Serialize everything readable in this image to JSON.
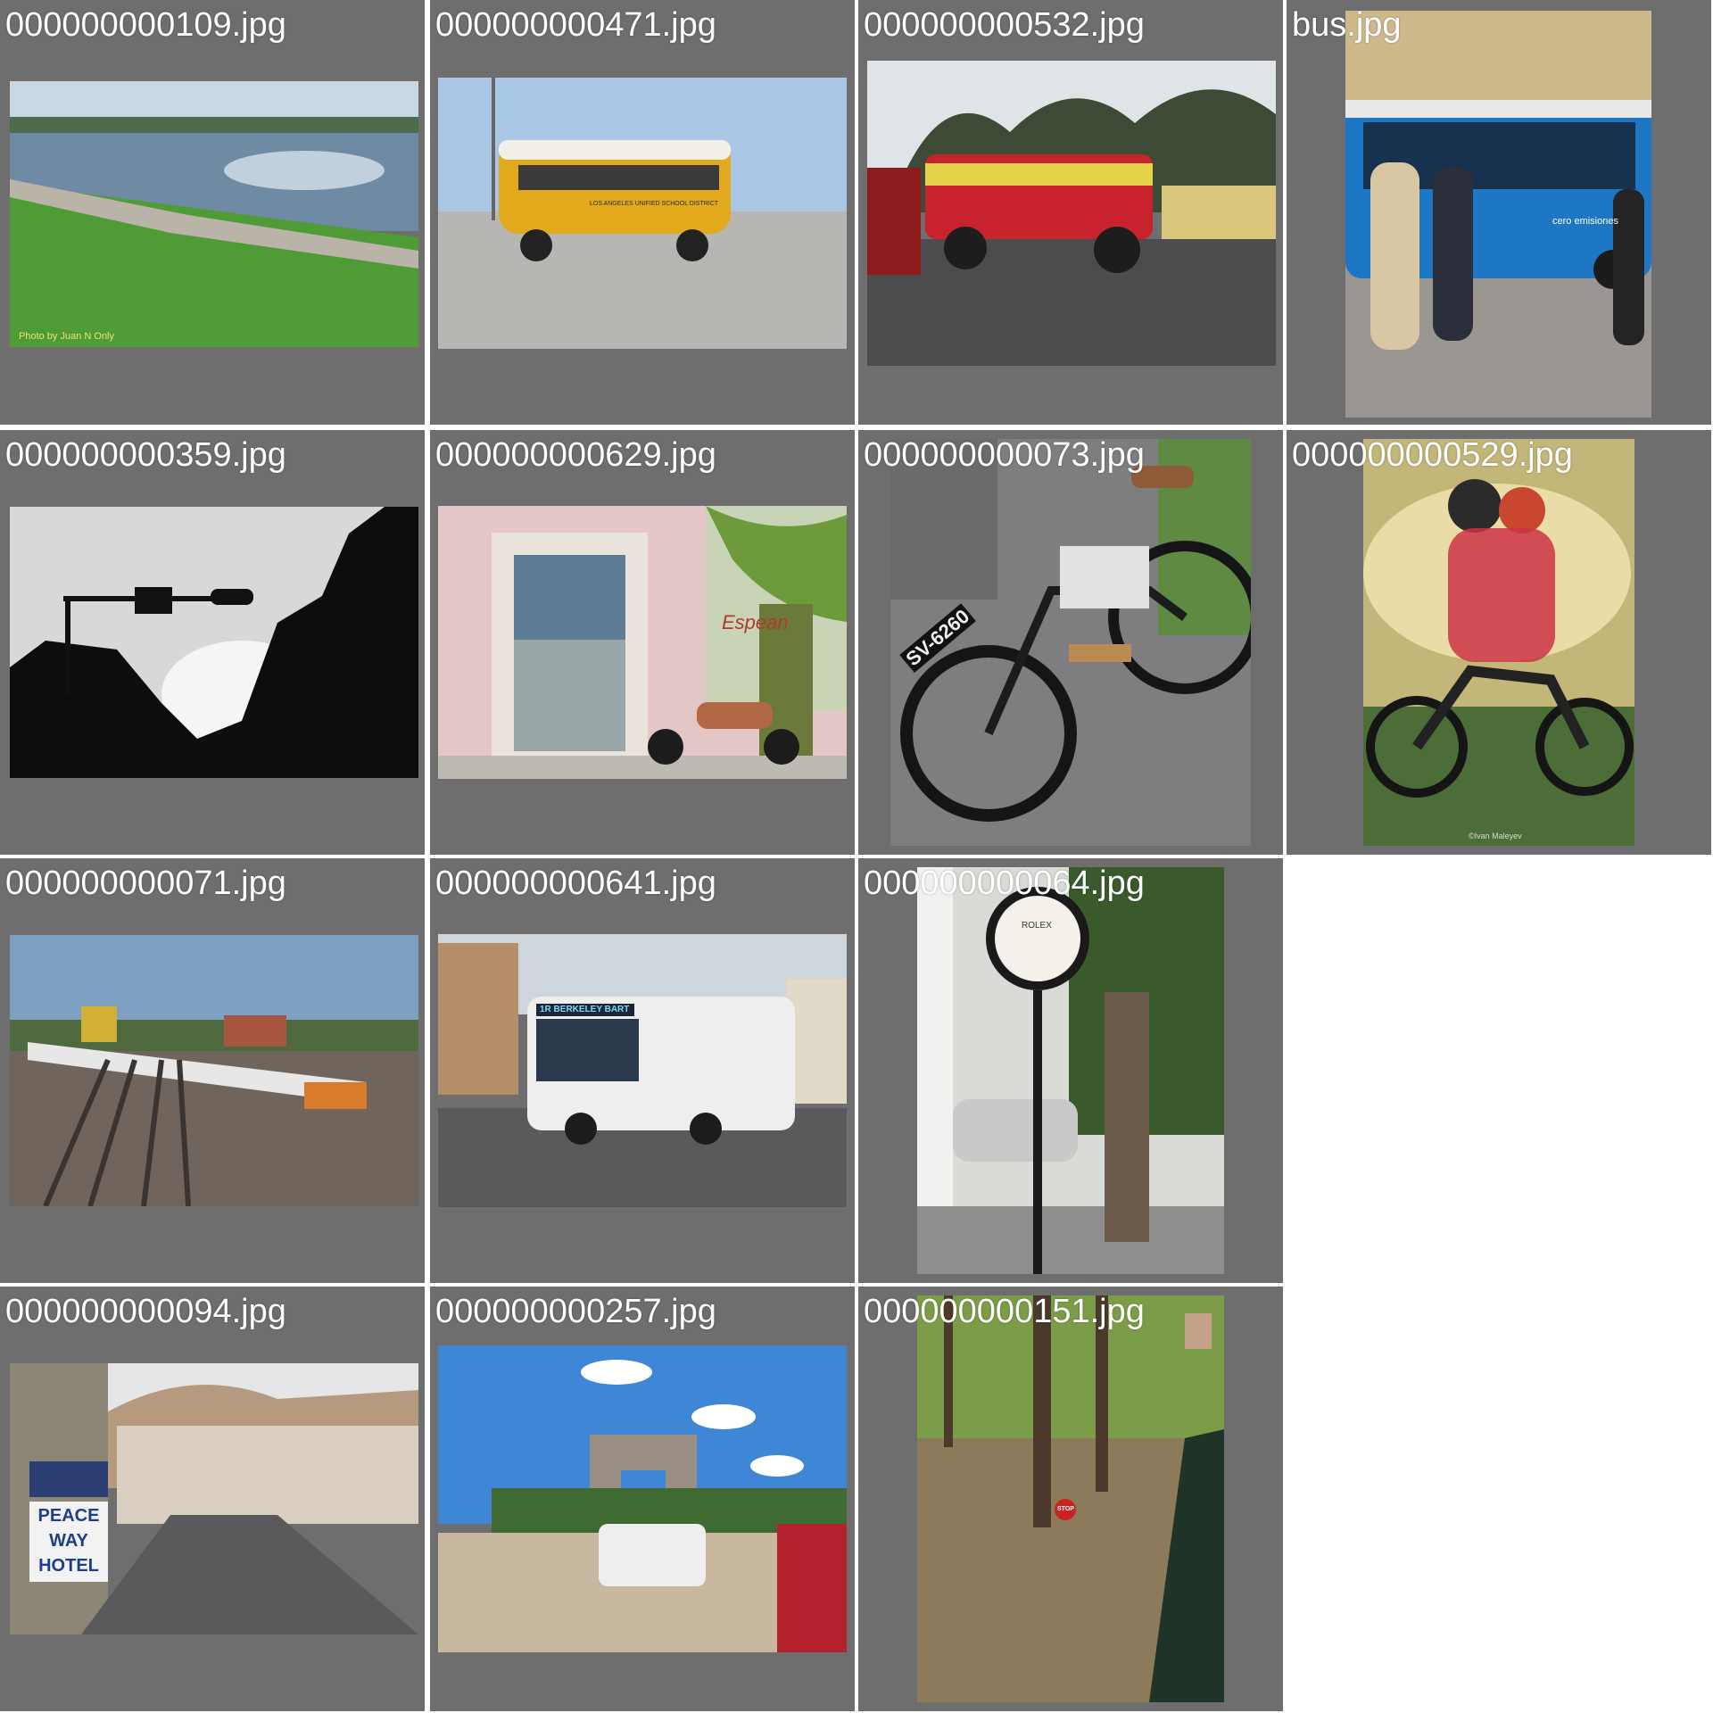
{
  "viewer": {
    "background": "#ffffff",
    "tile_background": "#6e6e6e",
    "label_color": "#ffffff"
  },
  "tiles": [
    {
      "filename": "000000000109.jpg",
      "icon": "waterfront-park-photo",
      "caption": "Photo by Juan N Only"
    },
    {
      "filename": "000000000471.jpg",
      "icon": "yellow-school-bus-photo",
      "bus_text": "LOS ANGELES UNIFIED SCHOOL DISTRICT"
    },
    {
      "filename": "000000000532.jpg",
      "icon": "chicken-bus-photo"
    },
    {
      "filename": "bus.jpg",
      "icon": "electric-bus-photo",
      "bus_text": "cero emisiones"
    },
    {
      "filename": "000000000359.jpg",
      "icon": "traffic-light-silhouette-photo"
    },
    {
      "filename": "000000000629.jpg",
      "icon": "door-and-minibike-photo",
      "wall_text": "Espean"
    },
    {
      "filename": "000000000073.jpg",
      "icon": "vintage-motorcycle-photo",
      "plate": "SV-6260"
    },
    {
      "filename": "000000000529.jpg",
      "icon": "dirt-bike-couple-photo",
      "credit": "©Ivan Maleyev"
    },
    {
      "filename": "000000000071.jpg",
      "icon": "train-yard-photo"
    },
    {
      "filename": "000000000641.jpg",
      "icon": "articulated-city-bus-photo",
      "route": "1R BERKELEY BART"
    },
    {
      "filename": "000000000064.jpg",
      "icon": "street-clock-photo",
      "clock_brand": "ROLEX"
    },
    {
      "filename": "000000000094.jpg",
      "icon": "hillside-street-hotel-photo",
      "hotel_sign": [
        "PEACE",
        "WAY",
        "HOTEL"
      ]
    },
    {
      "filename": "000000000257.jpg",
      "icon": "arch-plaza-food-truck-photo"
    },
    {
      "filename": "000000000151.jpg",
      "icon": "forest-train-window-photo",
      "stop_sign": "STOP"
    }
  ]
}
